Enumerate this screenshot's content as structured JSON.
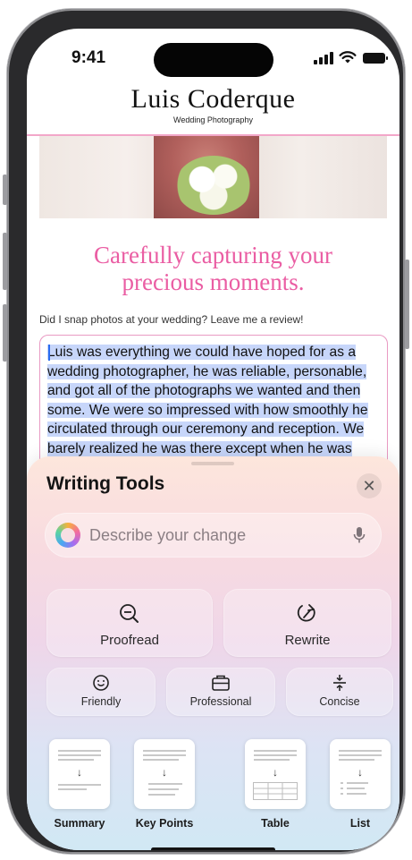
{
  "status_bar": {
    "time": "9:41"
  },
  "site": {
    "name": "Luis Coderque",
    "tagline": "Wedding Photography",
    "headline_line1": "Carefully capturing your",
    "headline_line2": "precious moments.",
    "review_prompt": "Did I snap photos at your wedding? Leave me a review!",
    "review_text": "Luis was everything we could have hoped for as a wedding photographer, he was reliable, personable, and got all of the photographs we wanted and then some. We were so impressed with how smoothly he circulated through our ceremony and reception. We barely realized he was there except when he was very"
  },
  "writing_tools": {
    "title": "Writing Tools",
    "close_icon": "xmark-icon",
    "search_placeholder": "Describe your change",
    "primary_actions": [
      {
        "label": "Proofread",
        "icon": "magnifier-minus-icon"
      },
      {
        "label": "Rewrite",
        "icon": "rewrite-arrow-icon"
      }
    ],
    "tone_actions": [
      {
        "label": "Friendly",
        "icon": "smiley-icon"
      },
      {
        "label": "Professional",
        "icon": "briefcase-icon"
      },
      {
        "label": "Concise",
        "icon": "compress-icon"
      }
    ],
    "format_actions": [
      {
        "label": "Summary",
        "icon": "summary-doc-icon"
      },
      {
        "label": "Key Points",
        "icon": "key-points-doc-icon"
      },
      {
        "label": "Table",
        "icon": "table-doc-icon"
      },
      {
        "label": "List",
        "icon": "list-doc-icon"
      }
    ]
  },
  "colors": {
    "accent_pink": "#ea5da3",
    "selection_blue": "#c7d6fa",
    "divider_pink": "#f2a7c9"
  }
}
